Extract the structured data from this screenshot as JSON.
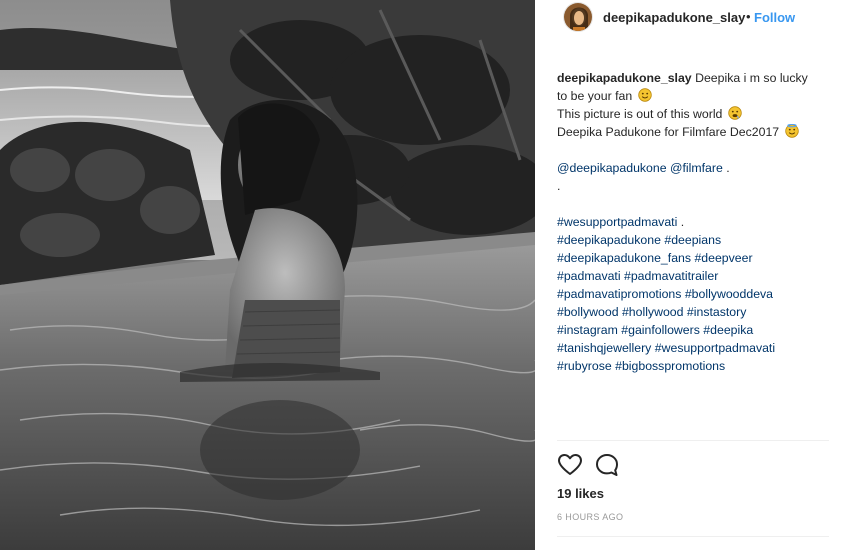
{
  "post": {
    "username": "deepikapadukone_slay",
    "separator": "•",
    "follow_label": "Follow",
    "caption_lines": [
      {
        "user": "deepikapadukone_slay",
        "text": " Deepika i m so lucky"
      },
      {
        "text": "to be your fan",
        "emoji": "smile"
      },
      {
        "text": "This picture is out of this world",
        "emoji": "drool"
      },
      {
        "text": "Deepika Padukone for Filmfare Dec2017",
        "emoji": "halo"
      },
      {
        "text": ""
      },
      {
        "mentions": [
          "@deepikapadukone",
          "@filmfare"
        ],
        "text": " ."
      },
      {
        "text": "."
      },
      {
        "text": ""
      },
      {
        "tags": [
          "#wesupportpadmavati"
        ],
        "text": " ."
      },
      {
        "tags": [
          "#deepikapadukone",
          "#deepians"
        ]
      },
      {
        "tags": [
          "#deepikapadukone_fans",
          "#deepveer"
        ]
      },
      {
        "tags": [
          "#padmavati",
          "#padmavatitrailer"
        ]
      },
      {
        "tags": [
          "#padmavatipromotions",
          "#bollywooddeva"
        ]
      },
      {
        "tags": [
          "#bollywood",
          "#hollywood",
          "#instastory"
        ]
      },
      {
        "tags": [
          "#instagram",
          "#gainfollowers",
          "#deepika"
        ]
      },
      {
        "tags": [
          "#tanishqjewellery",
          "#wesupportpadmavati"
        ]
      },
      {
        "tags": [
          "#rubyrose",
          "#bigbosspromotions"
        ]
      }
    ],
    "likes": "19 likes",
    "timestamp": "6 HOURS AGO"
  },
  "icons": {
    "like": "heart-outline-icon",
    "comment": "speech-bubble-icon",
    "emoji_smile": "smiling-face-emoji",
    "emoji_drool": "drooling-face-emoji",
    "emoji_halo": "halo-face-emoji"
  },
  "colors": {
    "link": "#003569",
    "follow": "#3897f0",
    "text": "#262626",
    "muted": "#999999",
    "emoji": "#f4c430"
  },
  "photo": {
    "description_icon": "photo-image",
    "tone": "black-and-white"
  }
}
